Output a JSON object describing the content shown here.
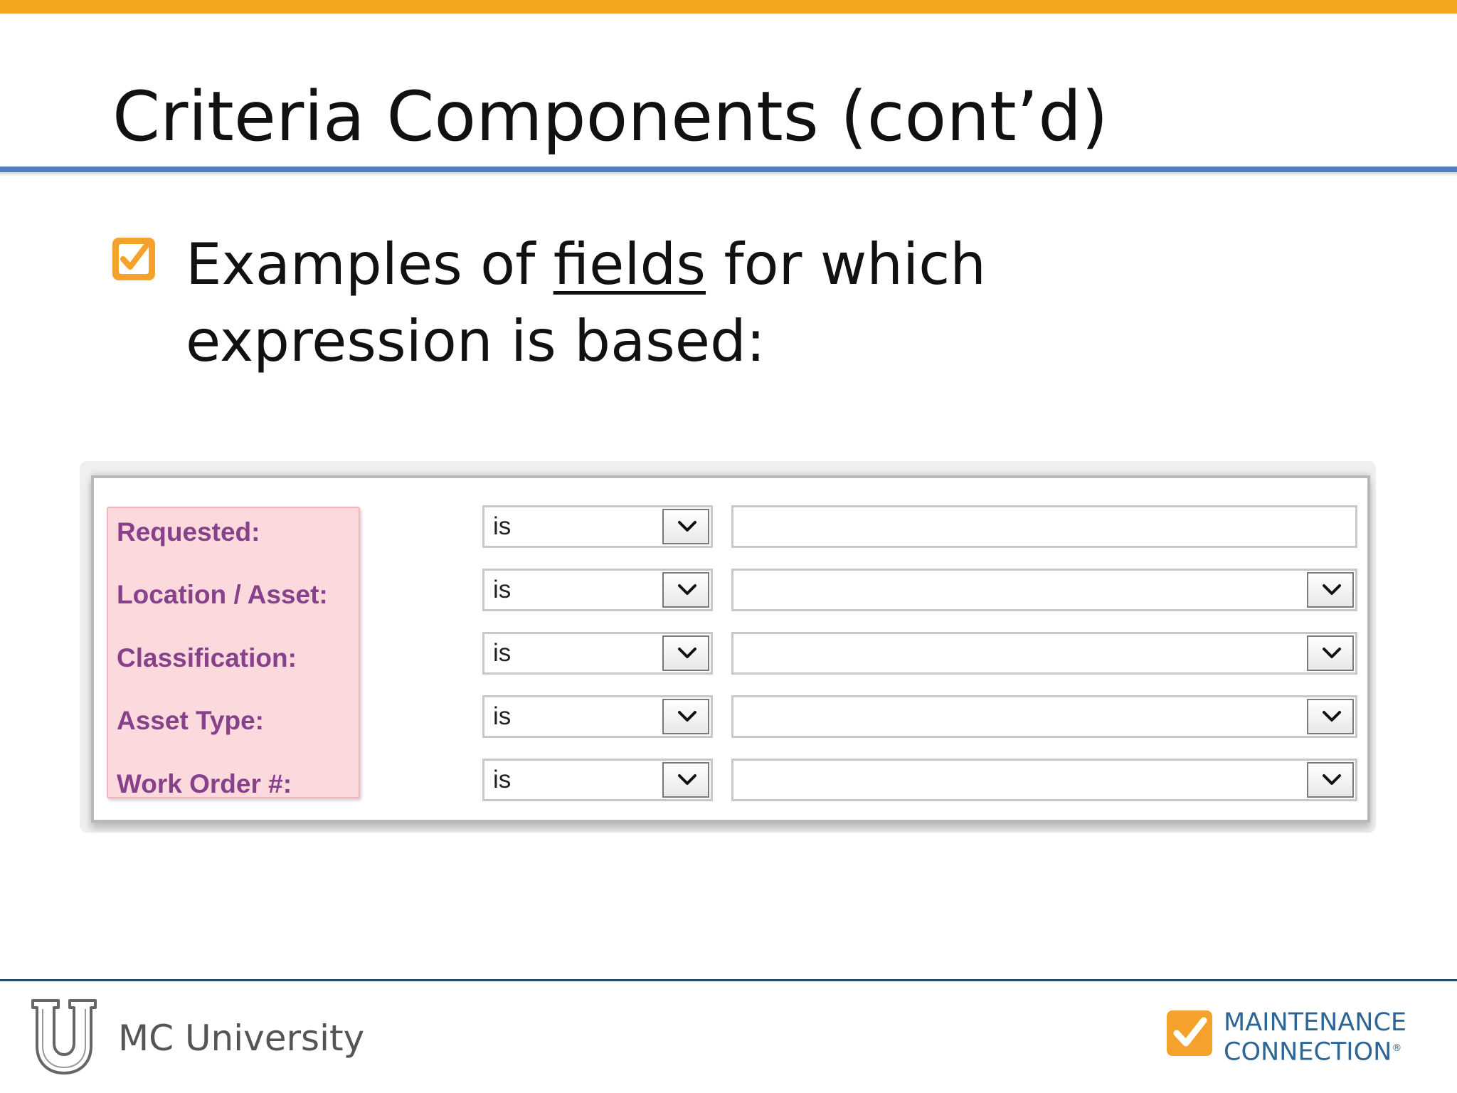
{
  "slide": {
    "title": "Criteria Components (cont’d)",
    "bullet": {
      "text_before": "Examples of ",
      "emphasis": "fields",
      "text_after": " for which expression is based:"
    }
  },
  "form": {
    "rows": [
      {
        "label": "Requested:",
        "operator": "is",
        "value": "",
        "value_has_dropdown": false
      },
      {
        "label": "Location / Asset:",
        "operator": "is",
        "value": "",
        "value_has_dropdown": true
      },
      {
        "label": "Classification:",
        "operator": "is",
        "value": "",
        "value_has_dropdown": true
      },
      {
        "label": "Asset Type:",
        "operator": "is",
        "value": "",
        "value_has_dropdown": true
      },
      {
        "label": "Work Order #:",
        "operator": "is",
        "value": "",
        "value_has_dropdown": true
      }
    ]
  },
  "footer": {
    "left_text": "MC University",
    "logo_line1": "MAINTENANCE",
    "logo_line2": "CONNECTION",
    "logo_mark": "®"
  },
  "icons": {
    "bullet": "checkbox-checked-icon",
    "dropdown": "chevron-down-icon",
    "university": "u-shield-logo",
    "brand": "checkmark-logo"
  },
  "colors": {
    "accent_orange": "#f2a51f",
    "title_rule_blue": "#4f7fc2",
    "label_purple": "#86418a",
    "label_highlight": "#fbd9dc",
    "footer_blue": "#2f6594"
  }
}
